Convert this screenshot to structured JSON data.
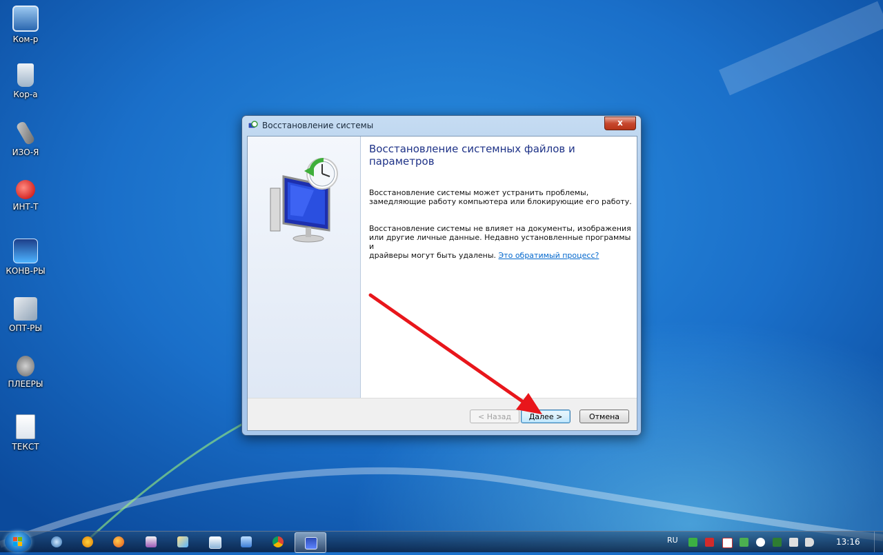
{
  "desktop": {
    "icons": [
      {
        "label": "Ком-р",
        "icon": "computer-icon"
      },
      {
        "label": "Кор-а",
        "icon": "recycle-bin-icon"
      },
      {
        "label": "ИЗО-Я",
        "icon": "graphics-tools-icon"
      },
      {
        "label": "ИНТ-Т",
        "icon": "internet-icon"
      },
      {
        "label": "КОНВ-РЫ",
        "icon": "converters-icon"
      },
      {
        "label": "ОПТ-РЫ",
        "icon": "optimizers-icon"
      },
      {
        "label": "ПЛЕЕРЫ",
        "icon": "players-icon"
      },
      {
        "label": "ТЕКСТ",
        "icon": "text-icon"
      }
    ]
  },
  "dialog": {
    "title": "Восстановление системы",
    "close_label": "x",
    "heading": "Восстановление системных файлов и параметров",
    "paragraph1_line1": "Восстановление системы может устранить проблемы,",
    "paragraph1_line2": "замедляющие работу компьютера или блокирующие его работу.",
    "paragraph2_line1": "Восстановление системы не влияет на документы, изображения",
    "paragraph2_line2": "или другие личные данные. Недавно установленные программы и",
    "paragraph2_line3": "драйверы могут быть удалены.",
    "link_text": "Это обратимый процесс?",
    "buttons": {
      "back": "< Назад",
      "next": "Далее >",
      "cancel": "Отмена"
    },
    "illustration_icon": "system-restore-monitor-clock-icon",
    "annotation_color": "#e8161b"
  },
  "taskbar": {
    "pinned": [
      "trillian-icon",
      "avast-icon",
      "firefox-icon",
      "monitor-tool-icon",
      "paint-icon",
      "media-icon",
      "display-icon",
      "chrome-icon",
      "system-restore-icon"
    ],
    "active_index": 8,
    "language": "RU",
    "tray_icons": [
      "green-app-icon",
      "red-book-icon",
      "flag-icon",
      "network-icon",
      "search-icon",
      "shield-icon",
      "power-icon",
      "speaker-icon"
    ],
    "clock": "13:16"
  }
}
